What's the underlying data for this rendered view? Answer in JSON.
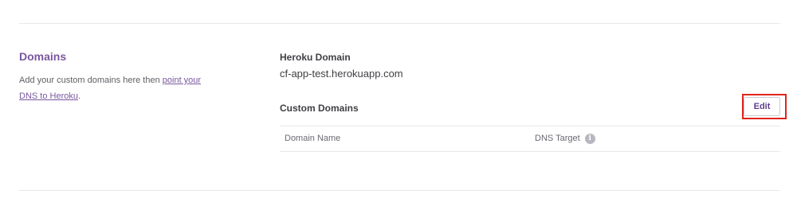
{
  "domains_section": {
    "title": "Domains",
    "description_prefix": "Add your custom domains here then ",
    "description_link": "point your DNS to Heroku",
    "description_suffix": "."
  },
  "heroku_domain": {
    "label": "Heroku Domain",
    "value": "cf-app-test.herokuapp.com"
  },
  "custom_domains": {
    "label": "Custom Domains",
    "edit_label": "Edit",
    "columns": [
      "Domain Name",
      "DNS Target"
    ],
    "info_icon": "info-icon"
  },
  "colors": {
    "accent": "#79589f",
    "highlight": "#e0231b"
  }
}
